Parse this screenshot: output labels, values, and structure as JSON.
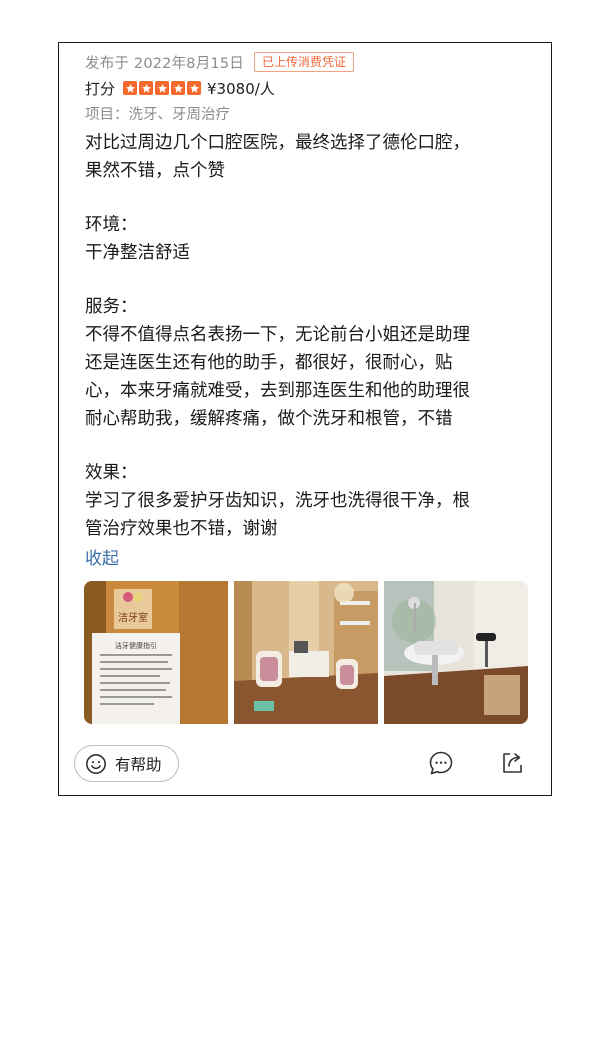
{
  "review": {
    "post_date": "发布于 2022年8月15日",
    "receipt_badge": "已上传消费凭证",
    "score_label": "打分",
    "rating_stars": 5,
    "price": "¥3080/人",
    "project": "项目：洗牙、牙周治疗",
    "paragraphs": [
      [
        "对比过周边几个口腔医院，最终选择了德伦口腔，",
        "果然不错，点个赞"
      ],
      [
        "环境：",
        "干净整洁舒适"
      ],
      [
        "服务：",
        "不得不值得点名表扬一下，无论前台小姐还是助理",
        "还是连医生还有他的助手，都很好，很耐心，贴",
        "心，本来牙痛就难受，去到那连医生和他的助理很",
        "耐心帮助我，缓解疼痛，做个洗牙和根管，不错"
      ],
      [
        "效果：",
        "学习了很多爱护牙齿知识，洗牙也洗得很干净，根",
        "管治疗效果也不错，谢谢"
      ]
    ],
    "collapse_label": "收起",
    "photos": [
      {
        "icon": "clinic-sign-photo",
        "sign_text": "洁牙室",
        "notice_title": "洁牙健康指引"
      },
      {
        "icon": "clinic-office-photo"
      },
      {
        "icon": "dental-chair-photo"
      }
    ],
    "actions": {
      "helpful_label": "有帮助",
      "helpful_icon": "smile-icon",
      "comment_icon": "comment-icon",
      "share_icon": "share-icon"
    }
  },
  "colors": {
    "accent_orange": "#f56a2e",
    "badge_orange": "#f0683c",
    "link_blue": "#3a6fa8",
    "muted_gray": "#8c8c8c"
  }
}
